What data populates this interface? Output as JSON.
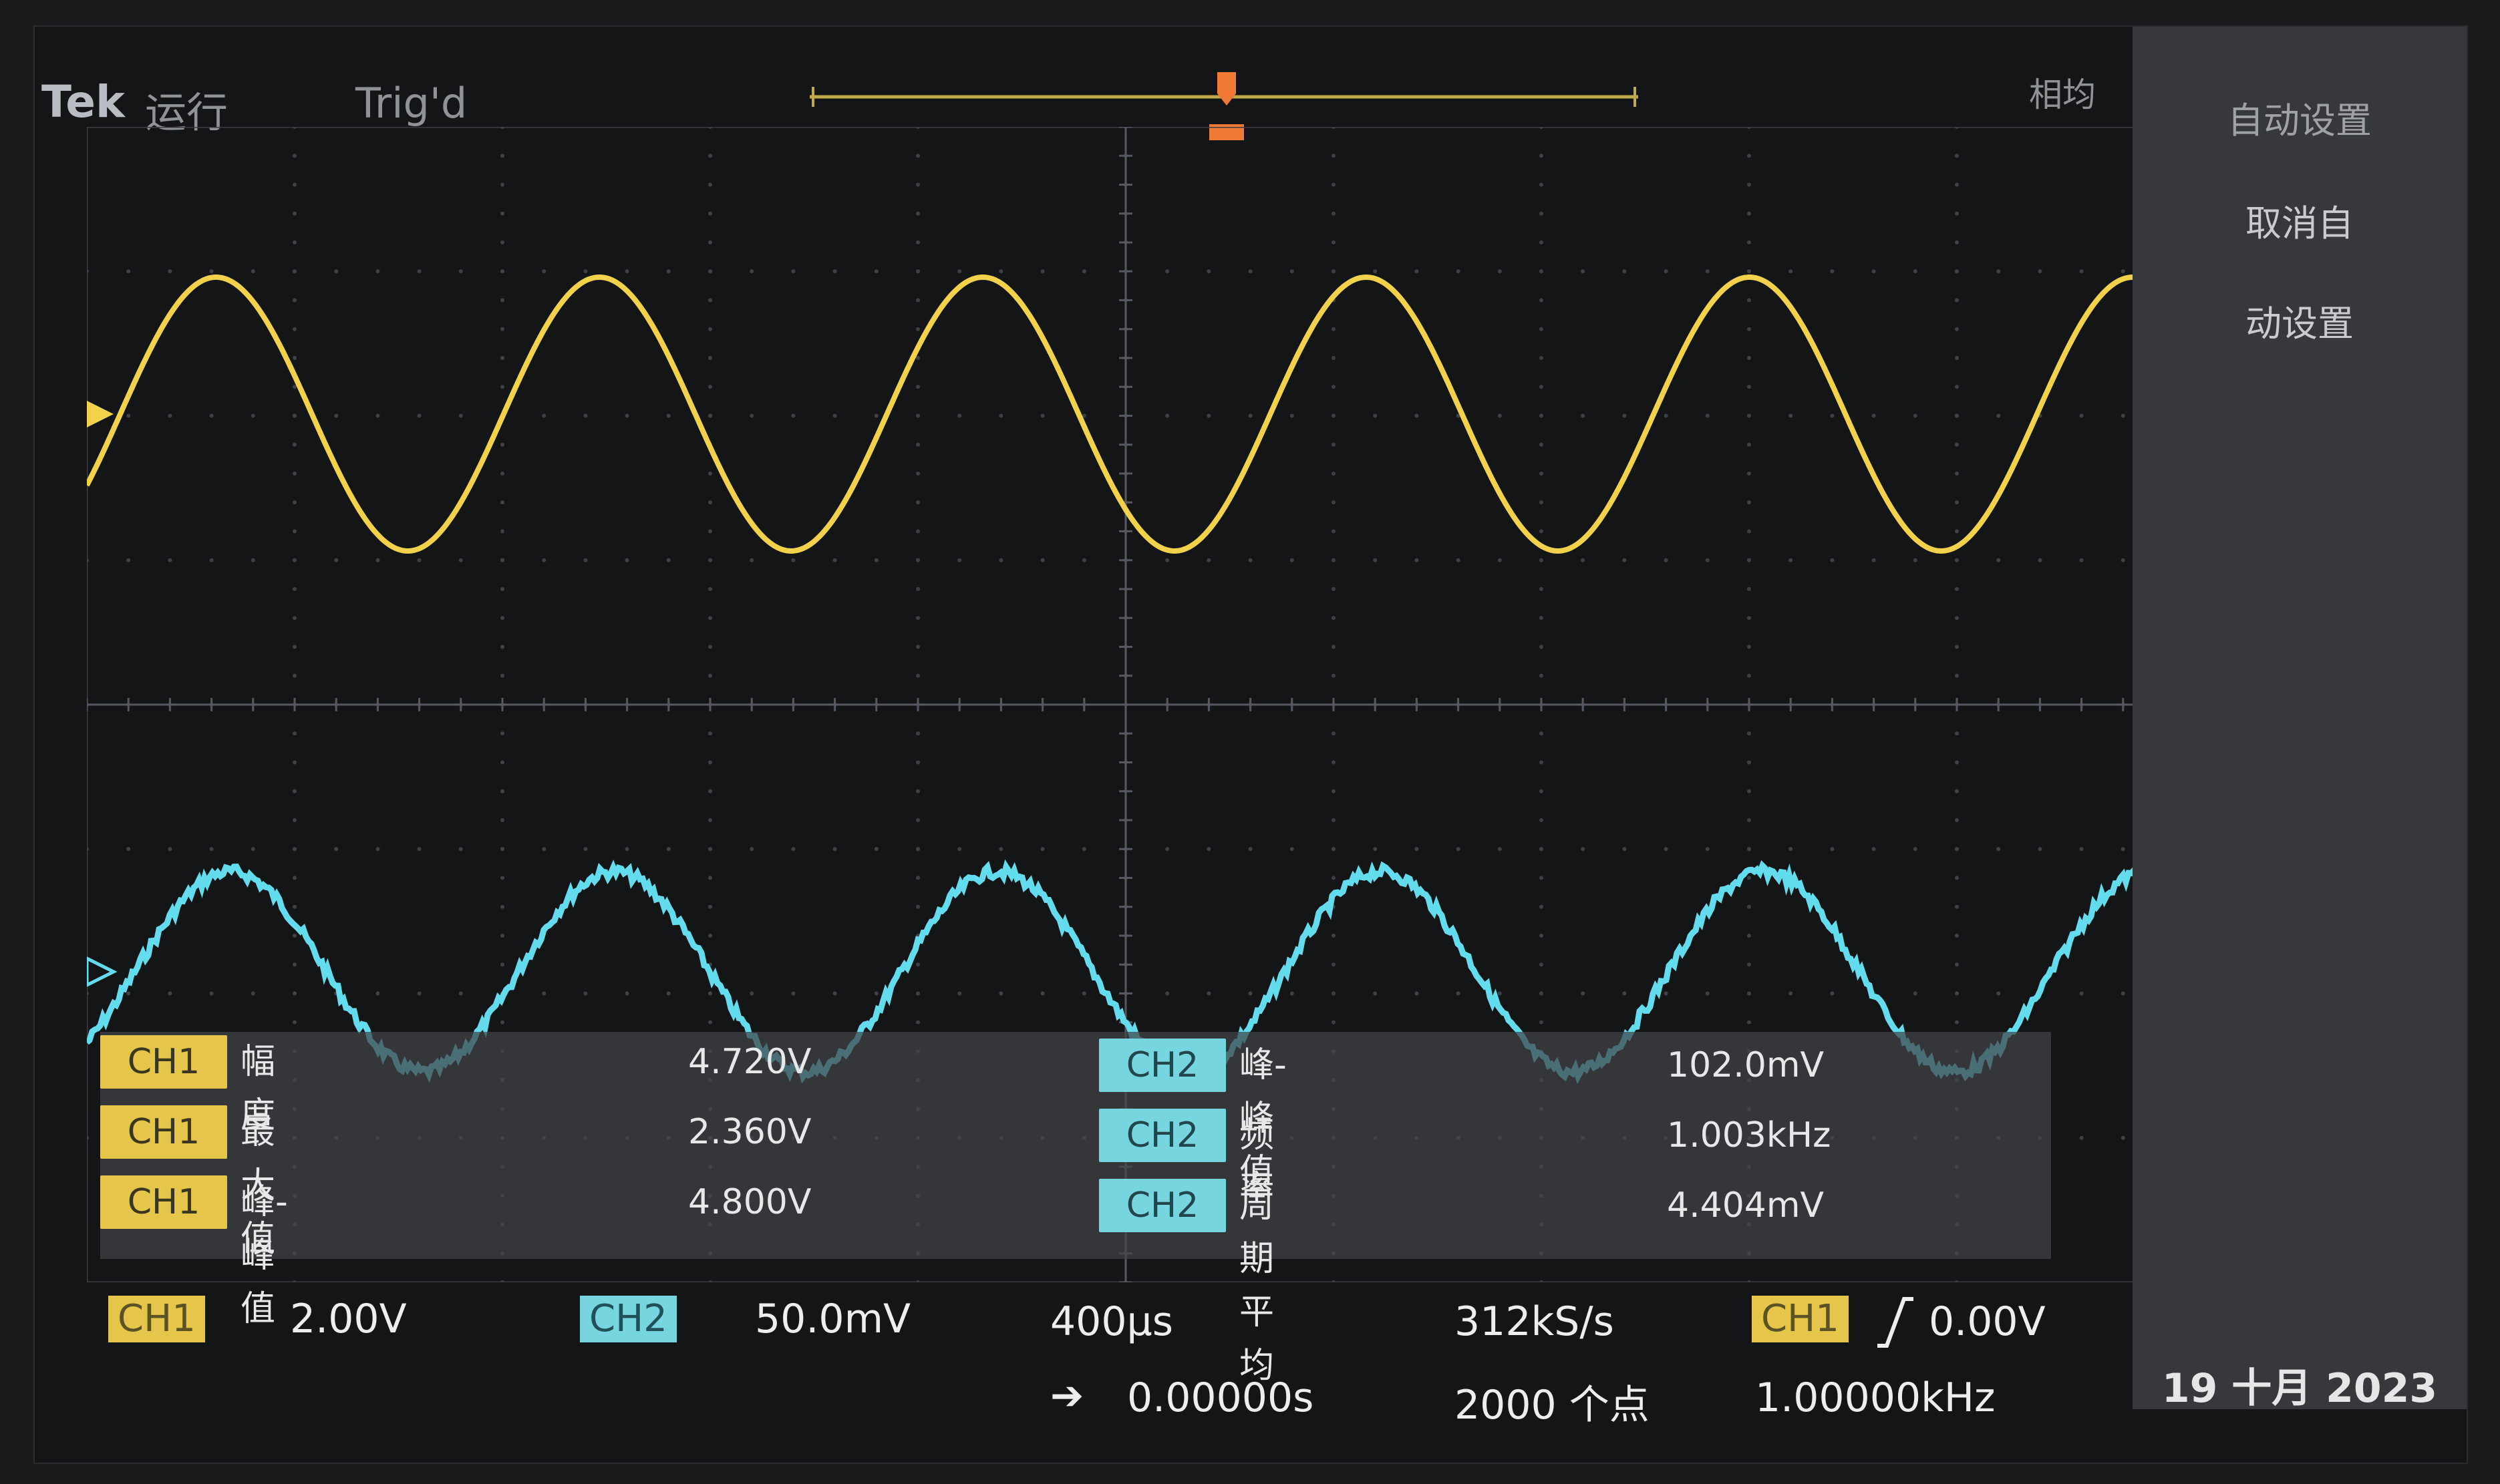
{
  "header": {
    "brand": "Tek",
    "run_state": "运行",
    "trigger_status": "Trig'd",
    "acquisition_mode": "相均"
  },
  "side_menu": {
    "items": [
      "自动设置",
      "取消自",
      "动设置"
    ]
  },
  "measurements": [
    {
      "channel": "CH1",
      "label": "幅度",
      "value": "4.720V"
    },
    {
      "channel": "CH1",
      "label": "最大值",
      "value": "2.360V"
    },
    {
      "channel": "CH1",
      "label": "峰-峰值",
      "value": "4.800V"
    },
    {
      "channel": "CH2",
      "label": "峰-峰值",
      "value": "102.0mV"
    },
    {
      "channel": "CH2",
      "label": "频率",
      "value": "1.003kHz"
    },
    {
      "channel": "CH2",
      "label": "周期平均",
      "value": "4.404mV"
    }
  ],
  "status": {
    "ch1_tag": "CH1",
    "ch1_scale": "2.00V",
    "ch2_tag": "CH2",
    "ch2_scale": "50.0mV",
    "timebase": "400µs",
    "horizontal_position": "0.00000s",
    "sample_rate": "312kS/s",
    "record_length": "2000 个点",
    "trigger_source": "CH1",
    "trigger_level": "0.00V",
    "trigger_frequency": "1.00000kHz",
    "date": "19 十月 2023"
  },
  "channel_markers": {
    "ch1": "1",
    "ch2": "2"
  },
  "colors": {
    "ch1": "#f2d24a",
    "ch2": "#63dced",
    "trigger": "#f07a35",
    "grid": "#3a3c40"
  }
}
